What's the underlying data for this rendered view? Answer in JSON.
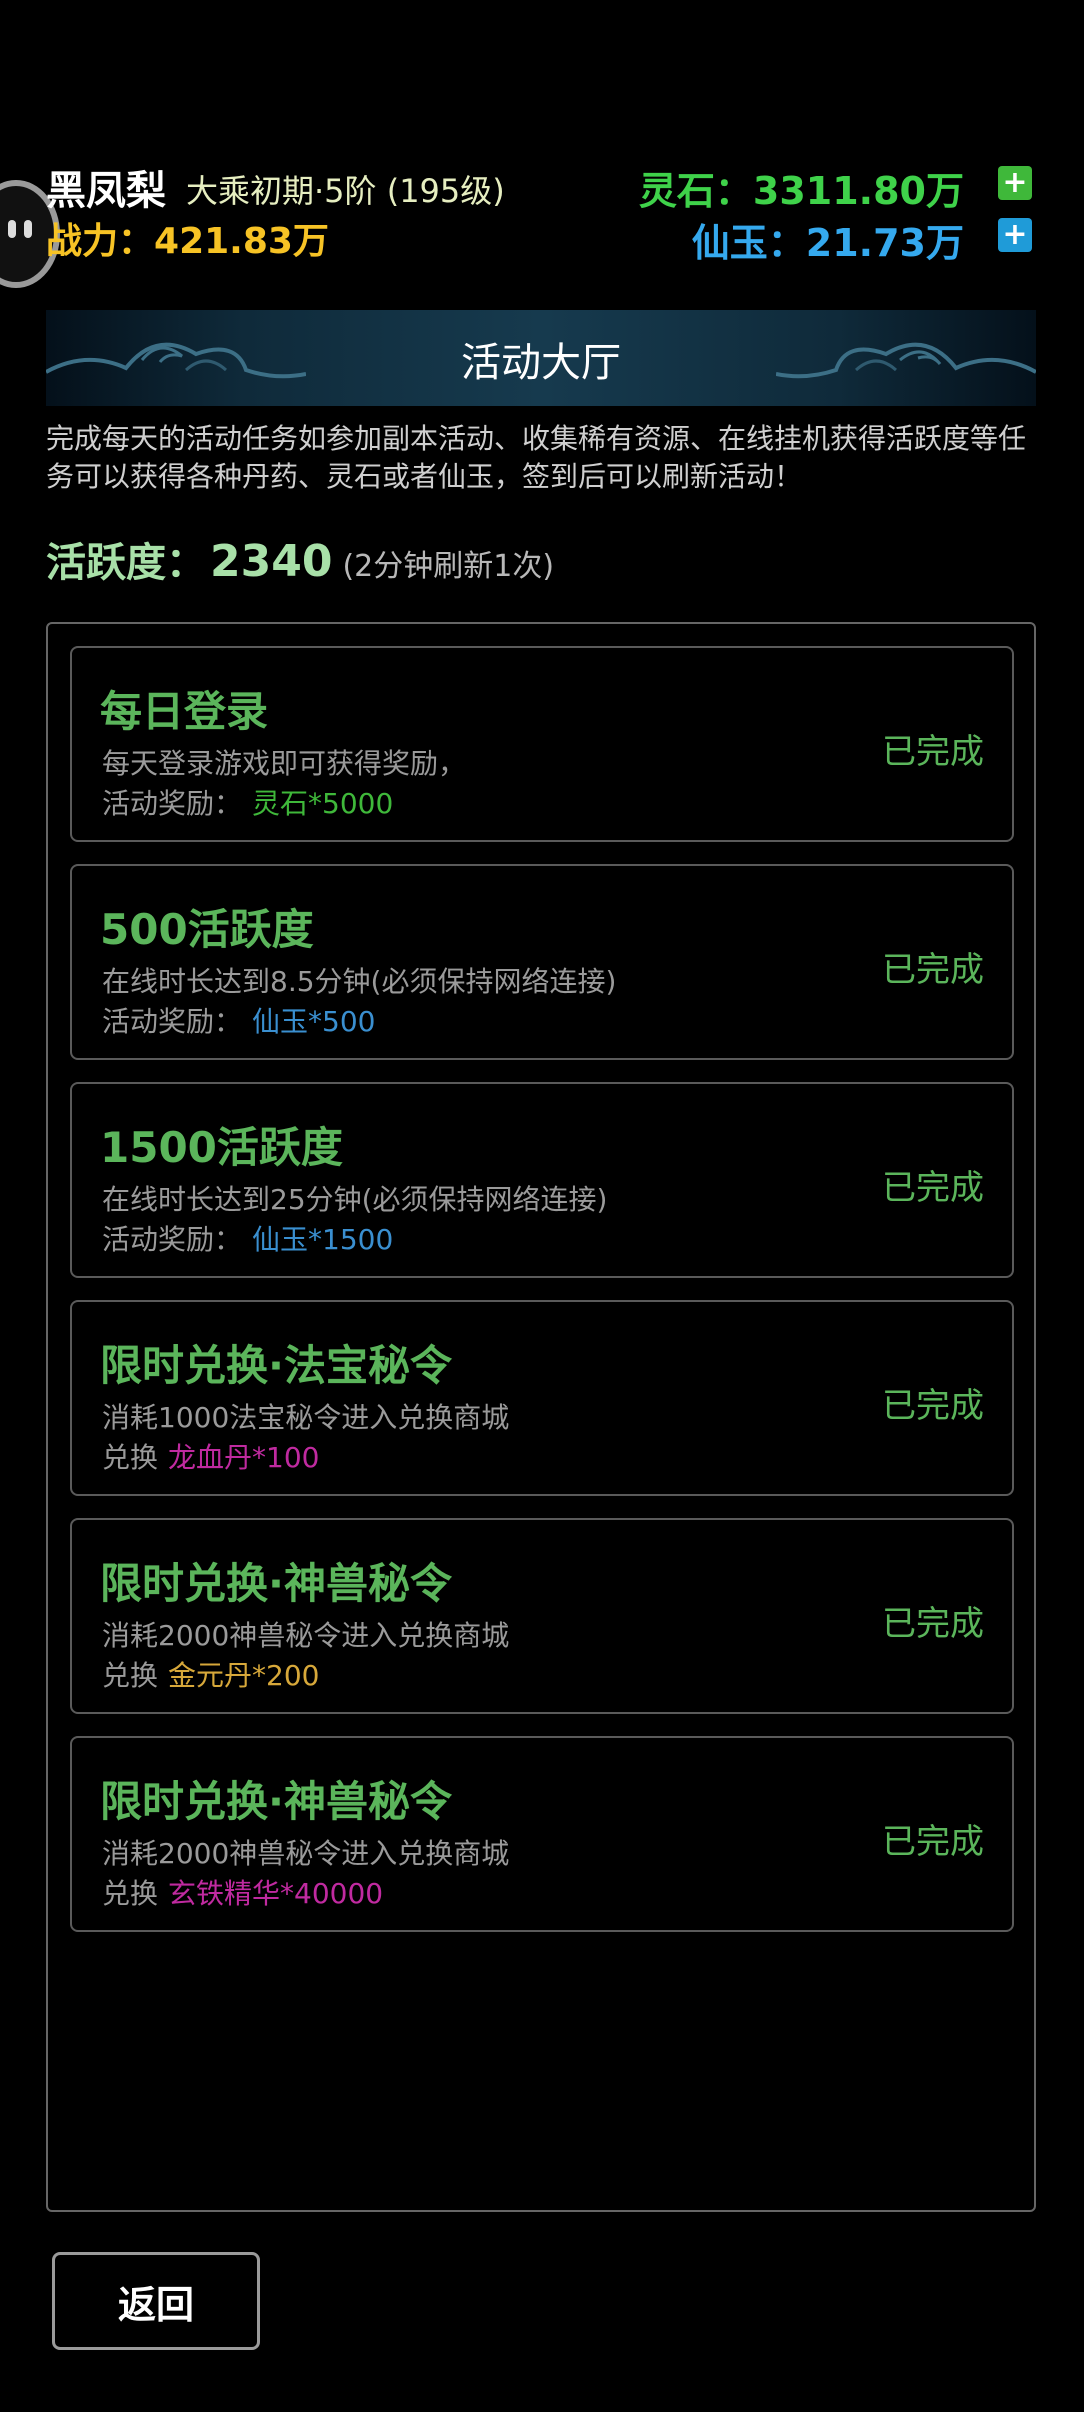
{
  "player": {
    "name": "黑凤梨",
    "rank": "大乘初期·5阶 (195级)",
    "power_label": "战力：",
    "power_value": "421.83万"
  },
  "currency": {
    "lingshi_label": "灵石：",
    "lingshi_value": "3311.80万",
    "xianyu_label": "仙玉：",
    "xianyu_value": "21.73万",
    "plus": "+"
  },
  "banner": {
    "title": "活动大厅"
  },
  "description": "完成每天的活动任务如参加副本活动、收集稀有资源、在线挂机获得活跃度等任务可以获得各种丹药、灵石或者仙玉，签到后可以刷新活动！",
  "activity": {
    "label": "活跃度：",
    "value": "2340",
    "note": "(2分钟刷新1次)"
  },
  "tasks": [
    {
      "title": "每日登录",
      "desc": "每天登录游戏即可获得奖励，",
      "reward_label": "活动奖励：",
      "reward_value": "灵石*5000",
      "reward_color": "#3fb83a",
      "status": "已完成"
    },
    {
      "title": "500活跃度",
      "desc": "在线时长达到8.5分钟(必须保持网络连接)",
      "reward_label": "活动奖励：",
      "reward_value": "仙玉*500",
      "reward_color": "#3a8fd0",
      "status": "已完成"
    },
    {
      "title": "1500活跃度",
      "desc": "在线时长达到25分钟(必须保持网络连接)",
      "reward_label": "活动奖励：",
      "reward_value": "仙玉*1500",
      "reward_color": "#3a8fd0",
      "status": "已完成"
    },
    {
      "title": "限时兑换·法宝秘令",
      "desc": "消耗1000法宝秘令进入兑换商城",
      "reward_label": "兑换",
      "reward_value": "龙血丹*100",
      "reward_color": "#c02aa0",
      "status": "已完成"
    },
    {
      "title": "限时兑换·神兽秘令",
      "desc": "消耗2000神兽秘令进入兑换商城",
      "reward_label": "兑换",
      "reward_value": "金元丹*200",
      "reward_color": "#d7a83a",
      "status": "已完成"
    },
    {
      "title": "限时兑换·神兽秘令",
      "desc": "消耗2000神兽秘令进入兑换商城",
      "reward_label": "兑换",
      "reward_value": "玄铁精华*40000",
      "reward_color": "#c02aa0",
      "status": "已完成"
    }
  ],
  "back_button": "返回"
}
